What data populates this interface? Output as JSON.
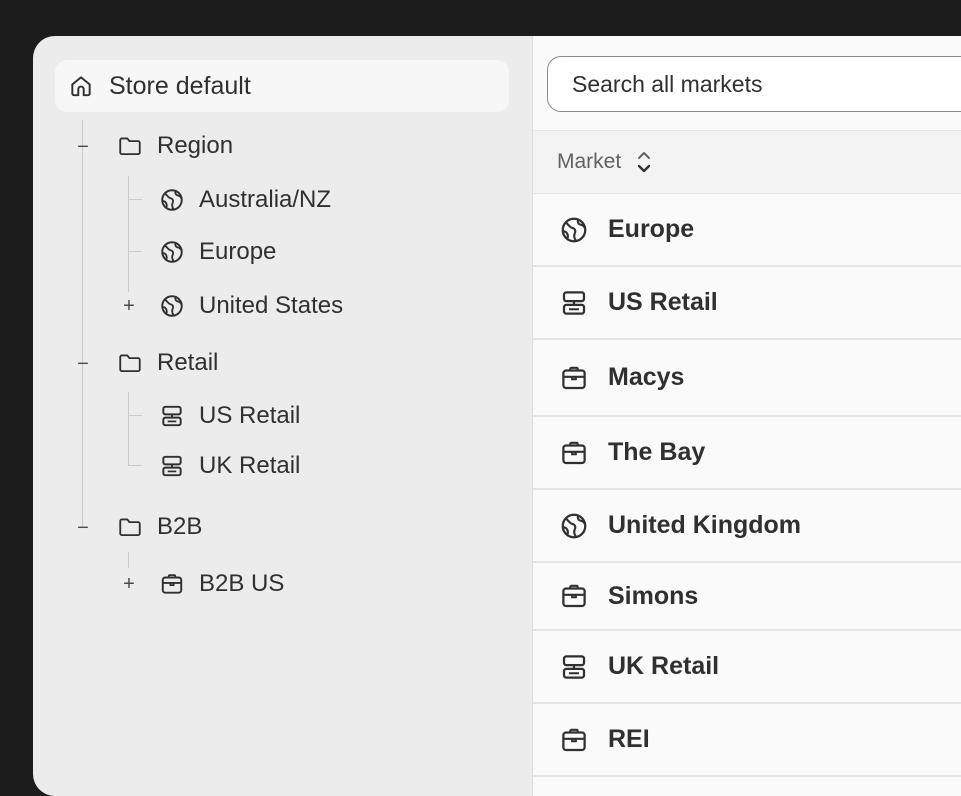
{
  "sidebar": {
    "root": {
      "label": "Store default",
      "icon": "home-icon"
    },
    "groups": [
      {
        "label": "Region",
        "icon": "folder-icon",
        "toggle": "−",
        "children": [
          {
            "label": "Australia/NZ",
            "icon": "globe-icon",
            "toggle": ""
          },
          {
            "label": "Europe",
            "icon": "globe-icon",
            "toggle": ""
          },
          {
            "label": "United States",
            "icon": "globe-icon",
            "toggle": "+"
          }
        ]
      },
      {
        "label": "Retail",
        "icon": "folder-icon",
        "toggle": "−",
        "children": [
          {
            "label": "US Retail",
            "icon": "pos-icon",
            "toggle": ""
          },
          {
            "label": "UK Retail",
            "icon": "pos-icon",
            "toggle": ""
          }
        ]
      },
      {
        "label": "B2B",
        "icon": "folder-icon",
        "toggle": "−",
        "children": [
          {
            "label": "B2B US",
            "icon": "briefcase-icon",
            "toggle": "+"
          }
        ]
      }
    ]
  },
  "search": {
    "placeholder": "Search all markets"
  },
  "table": {
    "column_header": "Market",
    "rows": [
      {
        "label": "Europe",
        "icon": "globe-icon"
      },
      {
        "label": "US Retail",
        "icon": "pos-icon"
      },
      {
        "label": "Macys",
        "icon": "briefcase-icon"
      },
      {
        "label": "The Bay",
        "icon": "briefcase-icon"
      },
      {
        "label": "United Kingdom",
        "icon": "globe-icon"
      },
      {
        "label": "Simons",
        "icon": "briefcase-icon"
      },
      {
        "label": "UK Retail",
        "icon": "pos-icon"
      },
      {
        "label": "REI",
        "icon": "briefcase-icon"
      }
    ]
  },
  "colors": {
    "background": "#1c1c1c",
    "sidebar": "#ececec",
    "panel": "#fafafa",
    "text": "#303030",
    "muted_text": "#616161"
  }
}
